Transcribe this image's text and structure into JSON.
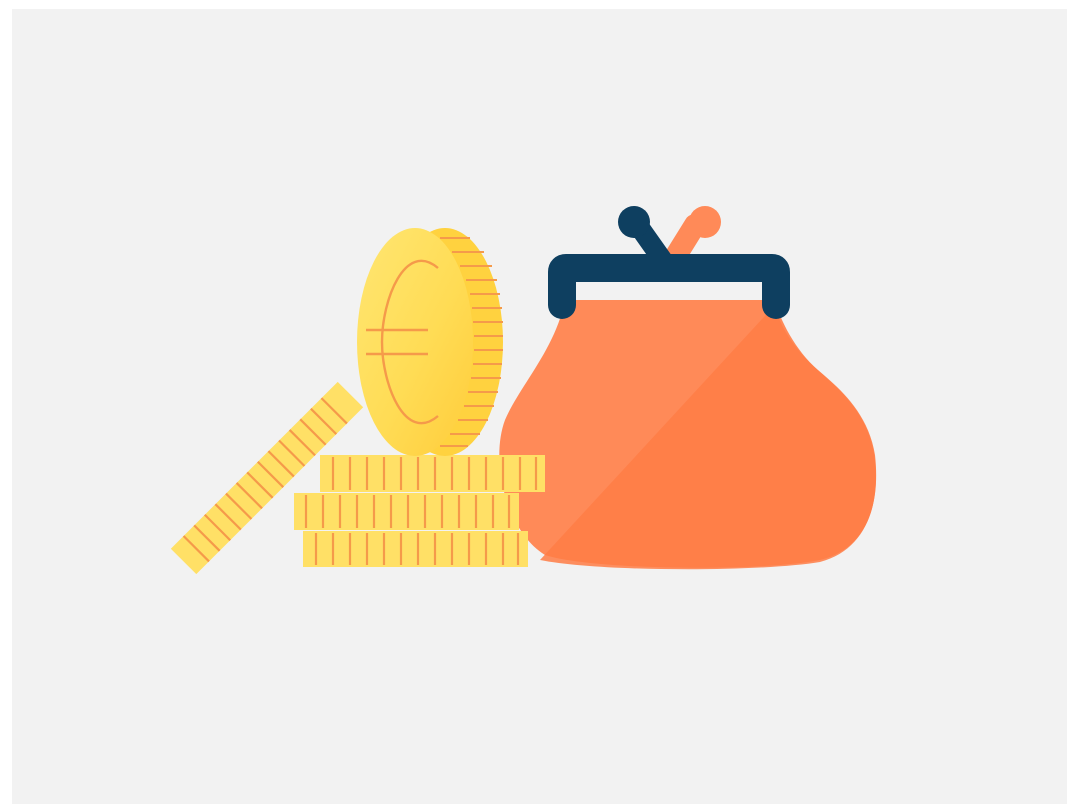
{
  "illustration": {
    "subject": "coin-purse-with-euro-coins",
    "icons": [
      "coin-purse-icon",
      "euro-coin-icon",
      "coin-stack-icon",
      "tilted-coin-icon"
    ],
    "colors": {
      "background": "#f2f2f2",
      "purse": "#ff8a55",
      "purse_shadow": "#ff7840",
      "clasp": "#0e3f60",
      "clasp_knob_accent": "#ff8a55",
      "coin": "#ffe066",
      "coin_edge": "#ffd23f",
      "coin_line": "#f59a4a"
    }
  }
}
